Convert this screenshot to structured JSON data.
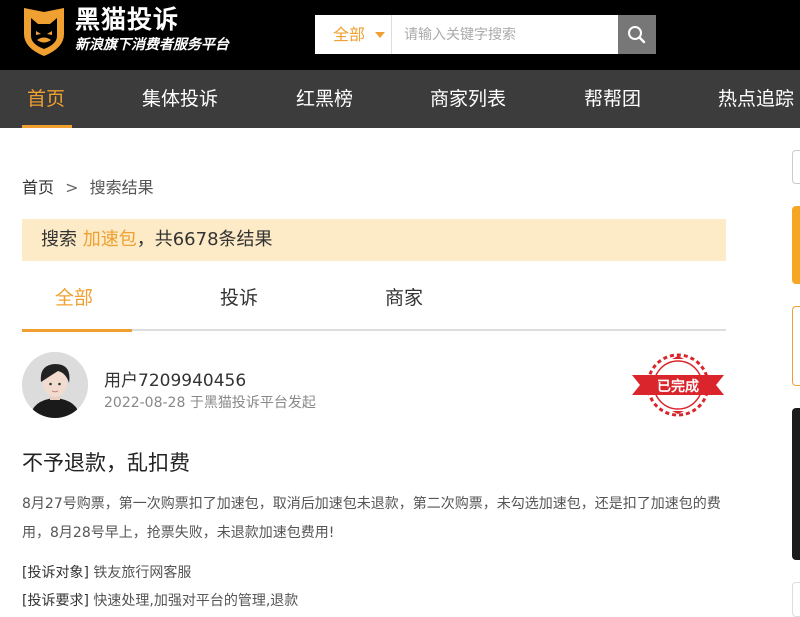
{
  "brand": {
    "name": "黑猫投诉",
    "slogan": "新浪旗下消费者服务平台",
    "logo_icon": "black-cat-shield-logo"
  },
  "search": {
    "scope_label": "全部",
    "placeholder": "请输入关键字搜索",
    "button_icon": "search-icon"
  },
  "nav": {
    "items": [
      {
        "label": "首页",
        "active": true
      },
      {
        "label": "集体投诉"
      },
      {
        "label": "红黑榜"
      },
      {
        "label": "商家列表"
      },
      {
        "label": "帮帮团"
      },
      {
        "label": "热点追踪"
      }
    ]
  },
  "breadcrumb": {
    "home": "首页",
    "separator": ">",
    "current": "搜索结果"
  },
  "result_summary": {
    "prefix": "搜索",
    "keyword": "加速包",
    "suffix": "，共6678条结果"
  },
  "tabs": [
    {
      "label": "全部",
      "active": true
    },
    {
      "label": "投诉"
    },
    {
      "label": "商家"
    }
  ],
  "complaint": {
    "username": "用户7209940456",
    "date": "2022-08-28",
    "source": "于黑猫投诉平台发起",
    "status_stamp": "已完成",
    "title": "不予退款，乱扣费",
    "body": "8月27号购票，第一次购票扣了加速包，取消后加速包未退款，第二次购票，未勾选加速包，还是扣了加速包的费用，8月28号早上，抢票失败，未退款加速包费用!",
    "target_label": "[投诉对象]",
    "target_value": "铁友旅行网客服",
    "demand_label": "[投诉要求]",
    "demand_value": "快速处理,加强对平台的管理,退款"
  },
  "colors": {
    "accent": "#f0a030",
    "topbar": "#000000",
    "navbar": "#3c3c3c",
    "highlight_bg": "#fdebc7",
    "stamp_red": "#d9252b"
  }
}
